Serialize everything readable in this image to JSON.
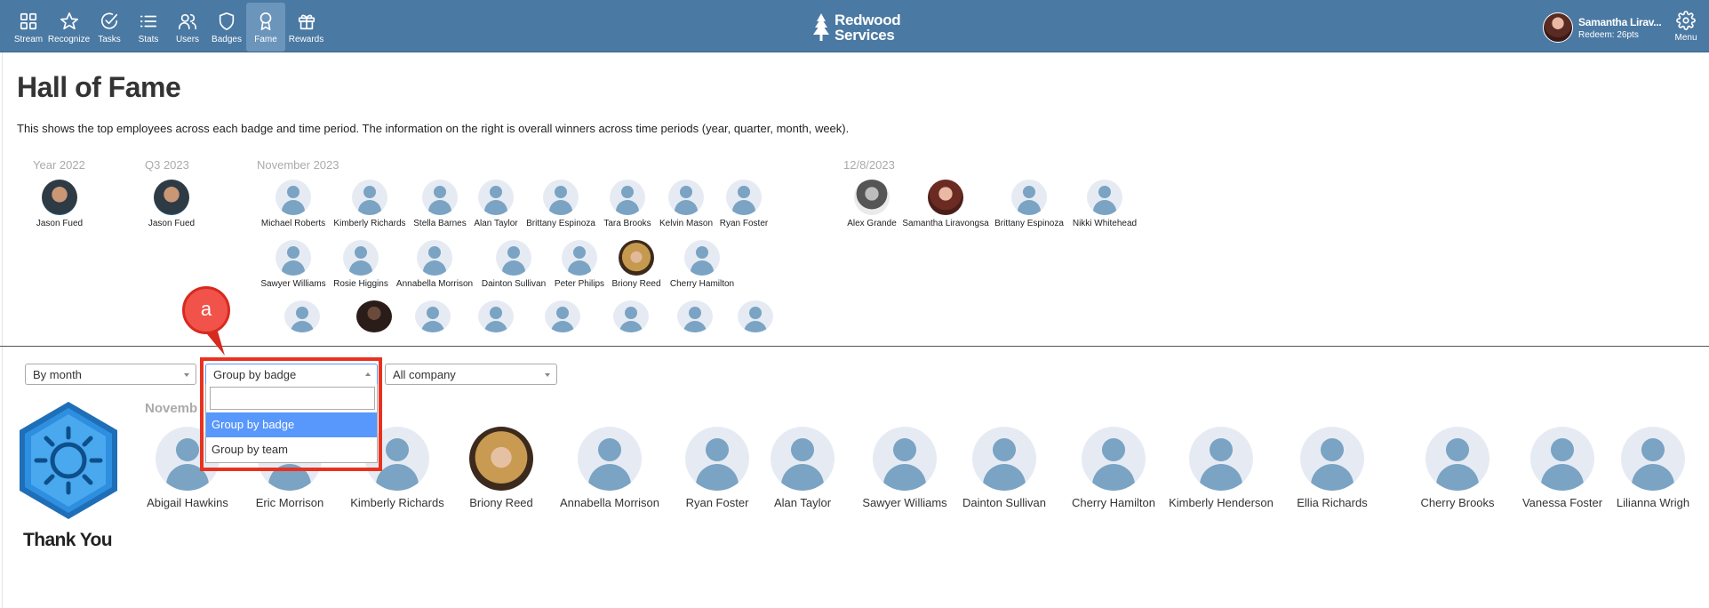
{
  "nav": {
    "items": [
      {
        "label": "Stream",
        "icon": "grid-icon"
      },
      {
        "label": "Recognize",
        "icon": "star-icon"
      },
      {
        "label": "Tasks",
        "icon": "check-circle-icon"
      },
      {
        "label": "Stats",
        "icon": "list-icon"
      },
      {
        "label": "Users",
        "icon": "users-icon"
      },
      {
        "label": "Badges",
        "icon": "shield-icon"
      },
      {
        "label": "Fame",
        "icon": "award-icon"
      },
      {
        "label": "Rewards",
        "icon": "gift-icon"
      }
    ],
    "active": "Fame"
  },
  "brand": {
    "line1": "Redwood",
    "line2": "Services"
  },
  "profile": {
    "name": "Samantha Lirav...",
    "points": "Redeem: 26pts"
  },
  "menu": {
    "label": "Menu"
  },
  "page": {
    "title": "Hall of Fame",
    "description": "This shows the top employees across each badge and time period. The information on the right is overall winners across time periods (year, quarter, month, week)."
  },
  "periods": {
    "year": {
      "label": "Year 2022",
      "people": [
        "Jason Fued"
      ]
    },
    "quarter": {
      "label": "Q3 2023",
      "people": [
        "Jason Fued"
      ]
    },
    "month": {
      "label": "November 2023",
      "row1": [
        "Michael Roberts",
        "Kimberly Richards",
        "Stella Barnes",
        "Alan Taylor",
        "Brittany Espinoza",
        "Tara Brooks",
        "Kelvin Mason",
        "Ryan Foster"
      ],
      "row2": [
        "Sawyer Williams",
        "Rosie Higgins",
        "Annabella Morrison",
        "Dainton Sullivan",
        "Peter Philips",
        "Briony Reed",
        "Cherry Hamilton"
      ]
    },
    "week": {
      "label": "12/8/2023",
      "people": [
        "Alex Grande",
        "Samantha Liravongsa",
        "Brittany Espinoza",
        "Nikki Whitehead"
      ]
    }
  },
  "filters": {
    "period": "By month",
    "grouping": "Group by badge",
    "scope": "All company",
    "grouping_options": [
      "Group by badge",
      "Group by team"
    ],
    "highlighted": "Group by badge"
  },
  "annotation": {
    "label": "a"
  },
  "badge_section": {
    "badge_name": "Thank You",
    "period_label": "Novemb",
    "people": [
      "Abigail Hawkins",
      "Eric Morrison",
      "Kimberly Richards",
      "Briony Reed",
      "Annabella Morrison",
      "Ryan Foster",
      "Alan Taylor",
      "Sawyer Williams",
      "Dainton Sullivan",
      "Cherry Hamilton",
      "Kimberly Henderson",
      "Ellia Richards",
      "Cherry Brooks",
      "Vanessa Foster",
      "Lilianna Wrigh"
    ]
  },
  "colors": {
    "topbar": "#4a79a3",
    "active_nav": "#6b95bb",
    "highlight": "#5897fb",
    "annotation": "#e8321f"
  }
}
